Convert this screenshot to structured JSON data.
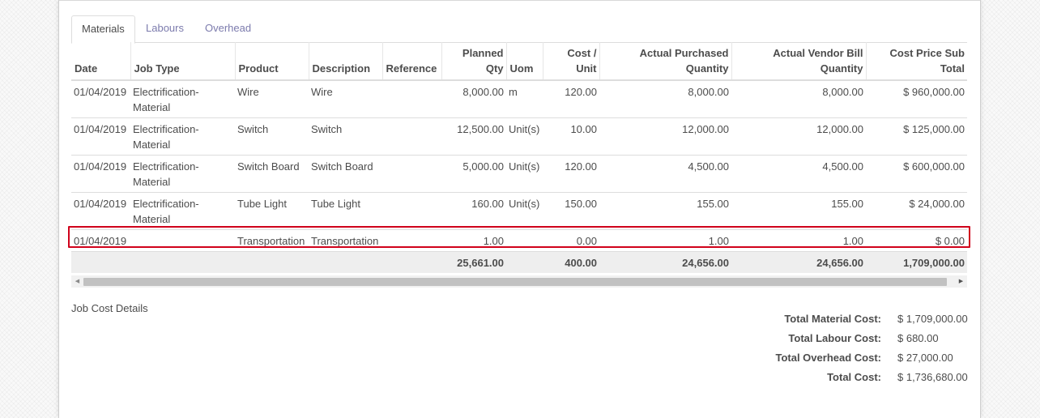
{
  "tabs": [
    {
      "label": "Materials",
      "active": true
    },
    {
      "label": "Labours",
      "active": false
    },
    {
      "label": "Overhead",
      "active": false
    }
  ],
  "table": {
    "headers": {
      "date": "Date",
      "job_type": "Job Type",
      "product": "Product",
      "description": "Description",
      "reference": "Reference",
      "planned_qty_1": "Planned",
      "planned_qty_2": "Qty",
      "uom": "Uom",
      "cost_unit_1": "Cost /",
      "cost_unit_2": "Unit",
      "actual_purchased_1": "Actual Purchased",
      "actual_purchased_2": "Quantity",
      "actual_vendor_bill_1": "Actual Vendor Bill",
      "actual_vendor_bill_2": "Quantity",
      "cost_price_sub_total_1": "Cost Price Sub",
      "cost_price_sub_total_2": "Total"
    },
    "rows": [
      {
        "date": "01/04/2019",
        "job_type": "Electrification-Material",
        "product": "Wire",
        "description": "Wire",
        "reference": "",
        "planned_qty": "8,000.00",
        "uom": "m",
        "cost_unit": "120.00",
        "actual_purchased": "8,000.00",
        "actual_vendor_bill": "8,000.00",
        "subtotal": "$ 960,000.00"
      },
      {
        "date": "01/04/2019",
        "job_type": "Electrification-Material",
        "product": "Switch",
        "description": "Switch",
        "reference": "",
        "planned_qty": "12,500.00",
        "uom": "Unit(s)",
        "cost_unit": "10.00",
        "actual_purchased": "12,000.00",
        "actual_vendor_bill": "12,000.00",
        "subtotal": "$ 125,000.00"
      },
      {
        "date": "01/04/2019",
        "job_type": "Electrification-Material",
        "product": "Switch Board",
        "description": "Switch Board",
        "reference": "",
        "planned_qty": "5,000.00",
        "uom": "Unit(s)",
        "cost_unit": "120.00",
        "actual_purchased": "4,500.00",
        "actual_vendor_bill": "4,500.00",
        "subtotal": "$ 600,000.00"
      },
      {
        "date": "01/04/2019",
        "job_type": "Electrification-Material",
        "product": "Tube Light",
        "description": "Tube Light",
        "reference": "",
        "planned_qty": "160.00",
        "uom": "Unit(s)",
        "cost_unit": "150.00",
        "actual_purchased": "155.00",
        "actual_vendor_bill": "155.00",
        "subtotal": "$ 24,000.00"
      },
      {
        "date": "01/04/2019",
        "job_type": "",
        "product": "Transportation",
        "description": "Transportation",
        "reference": "",
        "planned_qty": "1.00",
        "uom": "",
        "cost_unit": "0.00",
        "actual_purchased": "1.00",
        "actual_vendor_bill": "1.00",
        "subtotal": "$ 0.00"
      }
    ],
    "totals": {
      "planned_qty": "25,661.00",
      "cost_unit": "400.00",
      "actual_purchased": "24,656.00",
      "actual_vendor_bill": "24,656.00",
      "subtotal": "1,709,000.00"
    }
  },
  "details": {
    "label": "Job Cost Details",
    "items": [
      {
        "label": "Total Material Cost:",
        "value": "$ 1,709,000.00"
      },
      {
        "label": "Total Labour Cost:",
        "value": "$ 680.00"
      },
      {
        "label": "Total Overhead Cost:",
        "value": "$ 27,000.00"
      },
      {
        "label": "Total Cost:",
        "value": "$ 1,736,680.00"
      }
    ]
  },
  "colors": {
    "highlight": "#d0021b",
    "tab_link": "#7c7bad"
  }
}
